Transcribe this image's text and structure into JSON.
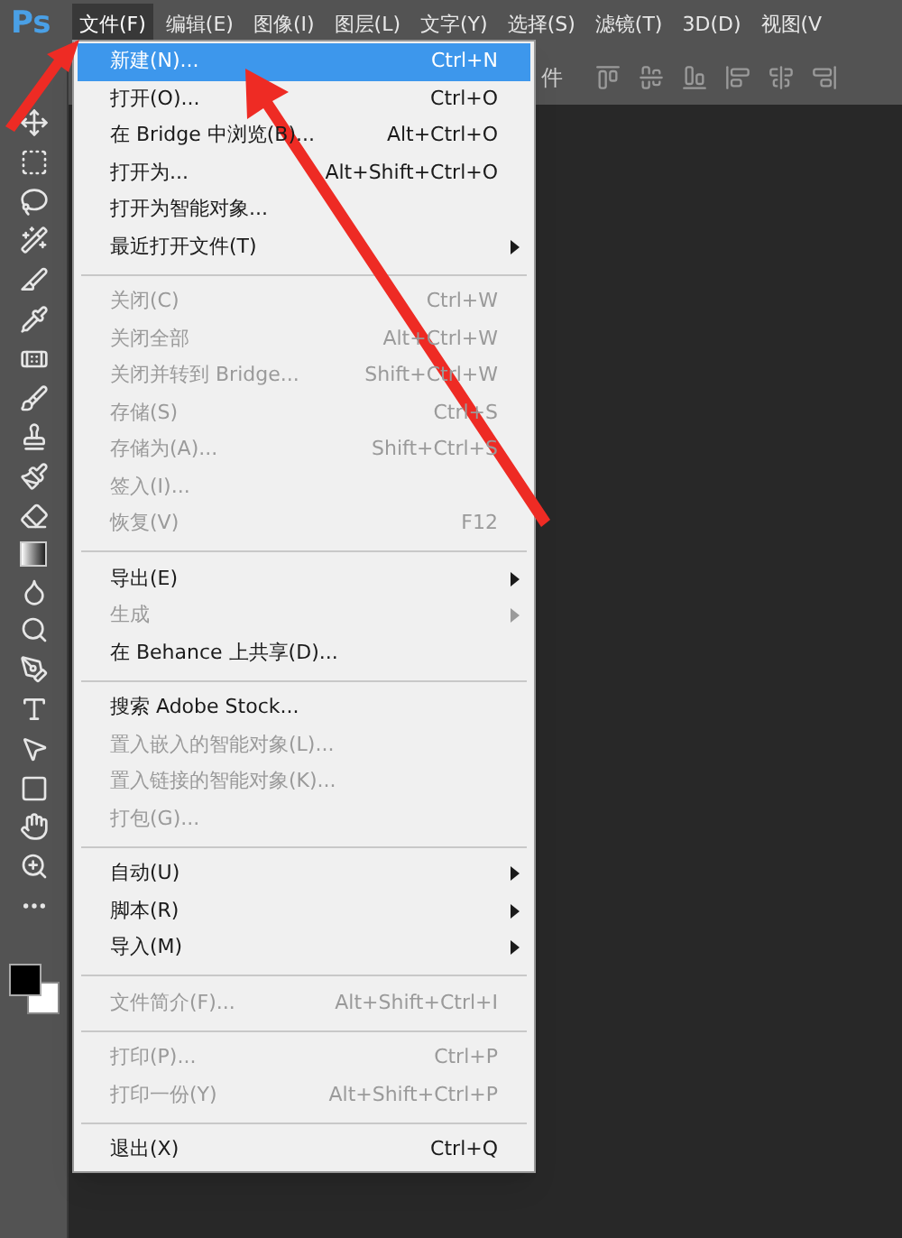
{
  "app": {
    "logo": "Ps"
  },
  "menubar": [
    {
      "label": "文件(F)",
      "selected": true
    },
    {
      "label": "编辑(E)",
      "selected": false
    },
    {
      "label": "图像(I)",
      "selected": false
    },
    {
      "label": "图层(L)",
      "selected": false
    },
    {
      "label": "文字(Y)",
      "selected": false
    },
    {
      "label": "选择(S)",
      "selected": false
    },
    {
      "label": "滤镜(T)",
      "selected": false
    },
    {
      "label": "3D(D)",
      "selected": false
    },
    {
      "label": "视图(V",
      "selected": false
    }
  ],
  "options_bar": {
    "label": "件"
  },
  "file_menu": [
    {
      "kind": "item",
      "label": "新建(N)...",
      "shortcut": "Ctrl+N",
      "disabled": false,
      "submenu": false,
      "selected": true
    },
    {
      "kind": "item",
      "label": "打开(O)...",
      "shortcut": "Ctrl+O",
      "disabled": false,
      "submenu": false,
      "selected": false
    },
    {
      "kind": "item",
      "label": "在 Bridge 中浏览(B)...",
      "shortcut": "Alt+Ctrl+O",
      "disabled": false,
      "submenu": false,
      "selected": false
    },
    {
      "kind": "item",
      "label": "打开为...",
      "shortcut": "Alt+Shift+Ctrl+O",
      "disabled": false,
      "submenu": false,
      "selected": false
    },
    {
      "kind": "item",
      "label": "打开为智能对象...",
      "disabled": false,
      "submenu": false,
      "selected": false
    },
    {
      "kind": "item",
      "label": "最近打开文件(T)",
      "disabled": false,
      "submenu": true,
      "selected": false
    },
    {
      "kind": "separator"
    },
    {
      "kind": "item",
      "label": "关闭(C)",
      "shortcut": "Ctrl+W",
      "disabled": true,
      "submenu": false,
      "selected": false
    },
    {
      "kind": "item",
      "label": "关闭全部",
      "shortcut": "Alt+Ctrl+W",
      "disabled": true,
      "submenu": false,
      "selected": false
    },
    {
      "kind": "item",
      "label": "关闭并转到 Bridge...",
      "shortcut": "Shift+Ctrl+W",
      "disabled": true,
      "submenu": false,
      "selected": false
    },
    {
      "kind": "item",
      "label": "存储(S)",
      "shortcut": "Ctrl+S",
      "disabled": true,
      "submenu": false,
      "selected": false
    },
    {
      "kind": "item",
      "label": "存储为(A)...",
      "shortcut": "Shift+Ctrl+S",
      "disabled": true,
      "submenu": false,
      "selected": false
    },
    {
      "kind": "item",
      "label": "签入(I)...",
      "disabled": true,
      "submenu": false,
      "selected": false
    },
    {
      "kind": "item",
      "label": "恢复(V)",
      "shortcut": "F12",
      "disabled": true,
      "submenu": false,
      "selected": false
    },
    {
      "kind": "separator"
    },
    {
      "kind": "item",
      "label": "导出(E)",
      "disabled": false,
      "submenu": true,
      "selected": false
    },
    {
      "kind": "item",
      "label": "生成",
      "disabled": true,
      "submenu": true,
      "selected": false
    },
    {
      "kind": "item",
      "label": "在 Behance 上共享(D)...",
      "disabled": false,
      "submenu": false,
      "selected": false
    },
    {
      "kind": "separator"
    },
    {
      "kind": "item",
      "label": "搜索 Adobe Stock...",
      "disabled": false,
      "submenu": false,
      "selected": false
    },
    {
      "kind": "item",
      "label": "置入嵌入的智能对象(L)...",
      "disabled": true,
      "submenu": false,
      "selected": false
    },
    {
      "kind": "item",
      "label": "置入链接的智能对象(K)...",
      "disabled": true,
      "submenu": false,
      "selected": false
    },
    {
      "kind": "item",
      "label": "打包(G)...",
      "disabled": true,
      "submenu": false,
      "selected": false
    },
    {
      "kind": "separator"
    },
    {
      "kind": "item",
      "label": "自动(U)",
      "disabled": false,
      "submenu": true,
      "selected": false
    },
    {
      "kind": "item",
      "label": "脚本(R)",
      "disabled": false,
      "submenu": true,
      "selected": false
    },
    {
      "kind": "item",
      "label": "导入(M)",
      "disabled": false,
      "submenu": true,
      "selected": false
    },
    {
      "kind": "separator"
    },
    {
      "kind": "item",
      "label": "文件简介(F)...",
      "shortcut": "Alt+Shift+Ctrl+I",
      "disabled": true,
      "submenu": false,
      "selected": false
    },
    {
      "kind": "separator"
    },
    {
      "kind": "item",
      "label": "打印(P)...",
      "shortcut": "Ctrl+P",
      "disabled": true,
      "submenu": false,
      "selected": false
    },
    {
      "kind": "item",
      "label": "打印一份(Y)",
      "shortcut": "Alt+Shift+Ctrl+P",
      "disabled": true,
      "submenu": false,
      "selected": false
    },
    {
      "kind": "separator"
    },
    {
      "kind": "item",
      "label": "退出(X)",
      "shortcut": "Ctrl+Q",
      "disabled": false,
      "submenu": false,
      "selected": false
    }
  ]
}
